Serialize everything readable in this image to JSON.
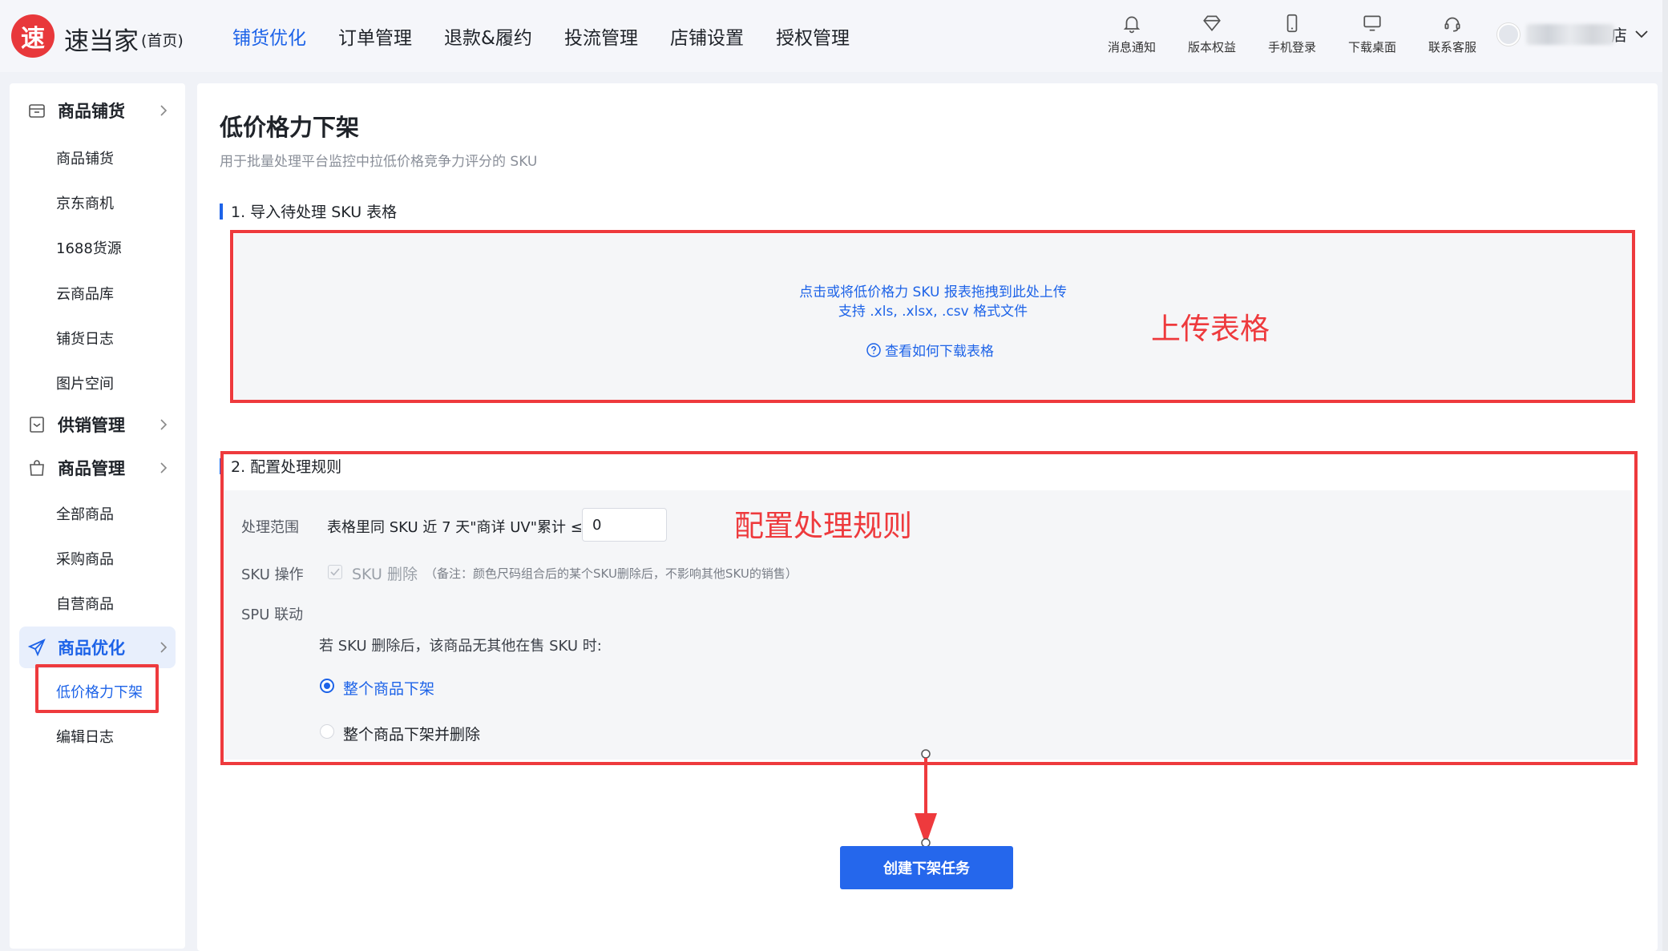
{
  "brand": {
    "logo_char": "速",
    "name": "速当家",
    "sub": "(首页)"
  },
  "topnav": [
    {
      "label": "铺货优化",
      "active": true
    },
    {
      "label": "订单管理"
    },
    {
      "label": "退款&履约"
    },
    {
      "label": "投流管理"
    },
    {
      "label": "店铺设置"
    },
    {
      "label": "授权管理"
    }
  ],
  "tools": [
    {
      "label": "消息通知",
      "icon": "bell-icon"
    },
    {
      "label": "版本权益",
      "icon": "diamond-icon"
    },
    {
      "label": "手机登录",
      "icon": "phone-icon"
    },
    {
      "label": "下载桌面",
      "icon": "monitor-icon"
    },
    {
      "label": "联系客服",
      "icon": "headset-icon"
    }
  ],
  "user": {
    "name_suffix": "店"
  },
  "sidebar": {
    "groups": [
      {
        "label": "商品铺货",
        "icon": "store-icon"
      },
      {
        "label": "供销管理",
        "icon": "box-icon"
      },
      {
        "label": "商品管理",
        "icon": "bag-icon"
      },
      {
        "label": "商品优化",
        "icon": "send-icon",
        "active": true
      }
    ],
    "items": [
      "商品铺货",
      "京东商机",
      "1688货源",
      "云商品库",
      "铺货日志",
      "图片空间",
      "全部商品",
      "采购商品",
      "自营商品",
      "低价格力下架",
      "编辑日志"
    ]
  },
  "page": {
    "title": "低价格力下架",
    "desc": "用于批量处理平台监控中拉低价格竞争力评分的 SKU"
  },
  "step1": {
    "title": "1. 导入待处理 SKU 表格",
    "upload_line1": "点击或将低价格力 SKU 报表拖拽到此处上传",
    "upload_line2": "支持 .xls, .xlsx, .csv 格式文件",
    "help_link": "查看如何下载表格",
    "annotation": "上传表格"
  },
  "step2": {
    "title": "2. 配置处理规则",
    "annotation": "配置处理规则",
    "scope_label": "处理范围",
    "scope_text": "表格里同 SKU 近 7 天\"商详 UV\"累计 ≤",
    "scope_value": "0",
    "sku_label": "SKU 操作",
    "sku_checkbox": "SKU 删除",
    "sku_note": "（备注：颜色尺码组合后的某个SKU删除后，不影响其他SKU的销售）",
    "spu_label": "SPU 联动",
    "spu_question": "若 SKU 删除后，该商品无其他在售 SKU 时:",
    "option1": "整个商品下架",
    "option2": "整个商品下架并删除",
    "selected_option": "整个商品下架"
  },
  "submit_label": "创建下架任务",
  "colors": {
    "accent": "#1d63e8",
    "annotation_red": "#ee3a3d",
    "logo_red": "#e8383b"
  }
}
